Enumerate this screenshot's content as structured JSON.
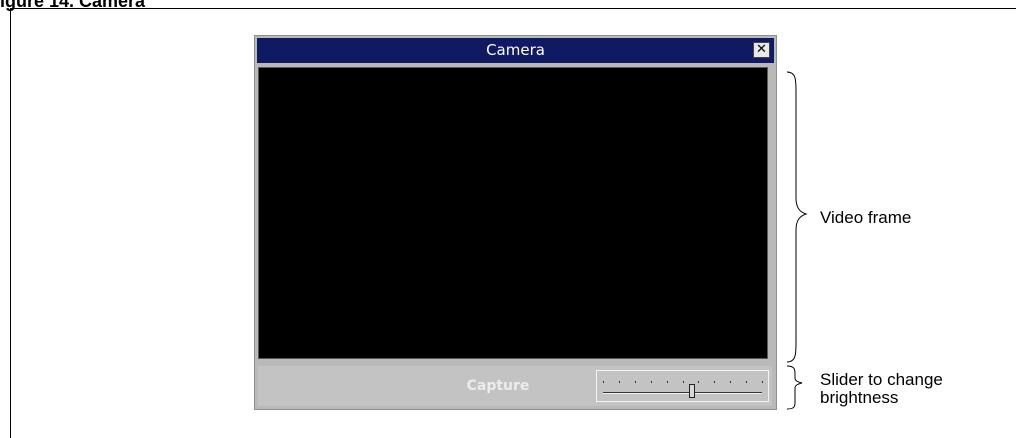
{
  "figure": {
    "caption": "igure 14. Camera"
  },
  "window": {
    "title": "Camera",
    "close_glyph": "✕",
    "capture_label": "Capture"
  },
  "brightness_slider": {
    "ticks": 11,
    "value_fraction": 0.56
  },
  "annotations": {
    "video_frame": "Video frame",
    "slider_line1": "Slider to change",
    "slider_line2": "brightness"
  }
}
